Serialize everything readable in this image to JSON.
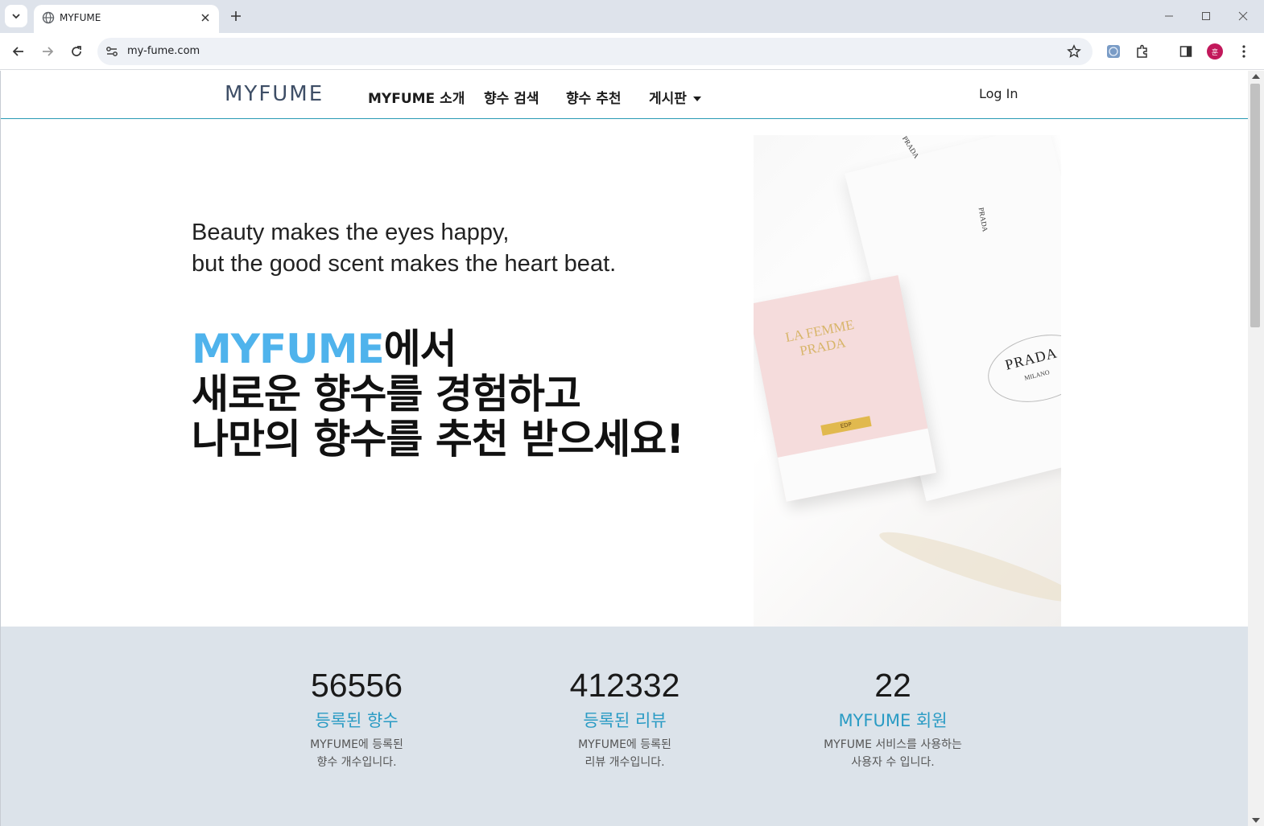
{
  "browser": {
    "tab_title": "MYFUME",
    "url": "my-fume.com",
    "profile_initial": "훈"
  },
  "site": {
    "logo": "MYFUME",
    "nav": {
      "about": "MYFUME 소개",
      "search": "향수 검색",
      "recommend": "향수 추천",
      "board": "게시판"
    },
    "login": "Log In"
  },
  "hero": {
    "tagline_line1": "Beauty makes the eyes happy,",
    "tagline_line2": "but the good scent makes the heart beat.",
    "headline_brand": "MYFUME",
    "headline_line1_suffix": "에서",
    "headline_line2": "새로운 향수를 경험하고",
    "headline_line3": "나만의 향수를 추천 받으세요!",
    "image_text": {
      "prada": "PRADA",
      "milano": "MILANO",
      "ribbon1": "PRADA",
      "ribbon2": "PRADA",
      "box_title_1": "LA FEMME",
      "box_title_2": "PRADA",
      "box_tag": "EDP"
    }
  },
  "stats": [
    {
      "value": "56556",
      "label": "등록된 향수",
      "desc_line1": "MYFUME에 등록된",
      "desc_line2": "향수 개수입니다."
    },
    {
      "value": "412332",
      "label": "등록된 리뷰",
      "desc_line1": "MYFUME에 등록된",
      "desc_line2": "리뷰 개수입니다."
    },
    {
      "value": "22",
      "label": "MYFUME 회원",
      "desc_line1": "MYFUME 서비스를 사용하는",
      "desc_line2": "사용자 수 입니다."
    }
  ],
  "colors": {
    "brand_blue": "#4fb3ec",
    "accent_teal": "#2a9bc4",
    "stats_bg": "#dce3ea"
  }
}
